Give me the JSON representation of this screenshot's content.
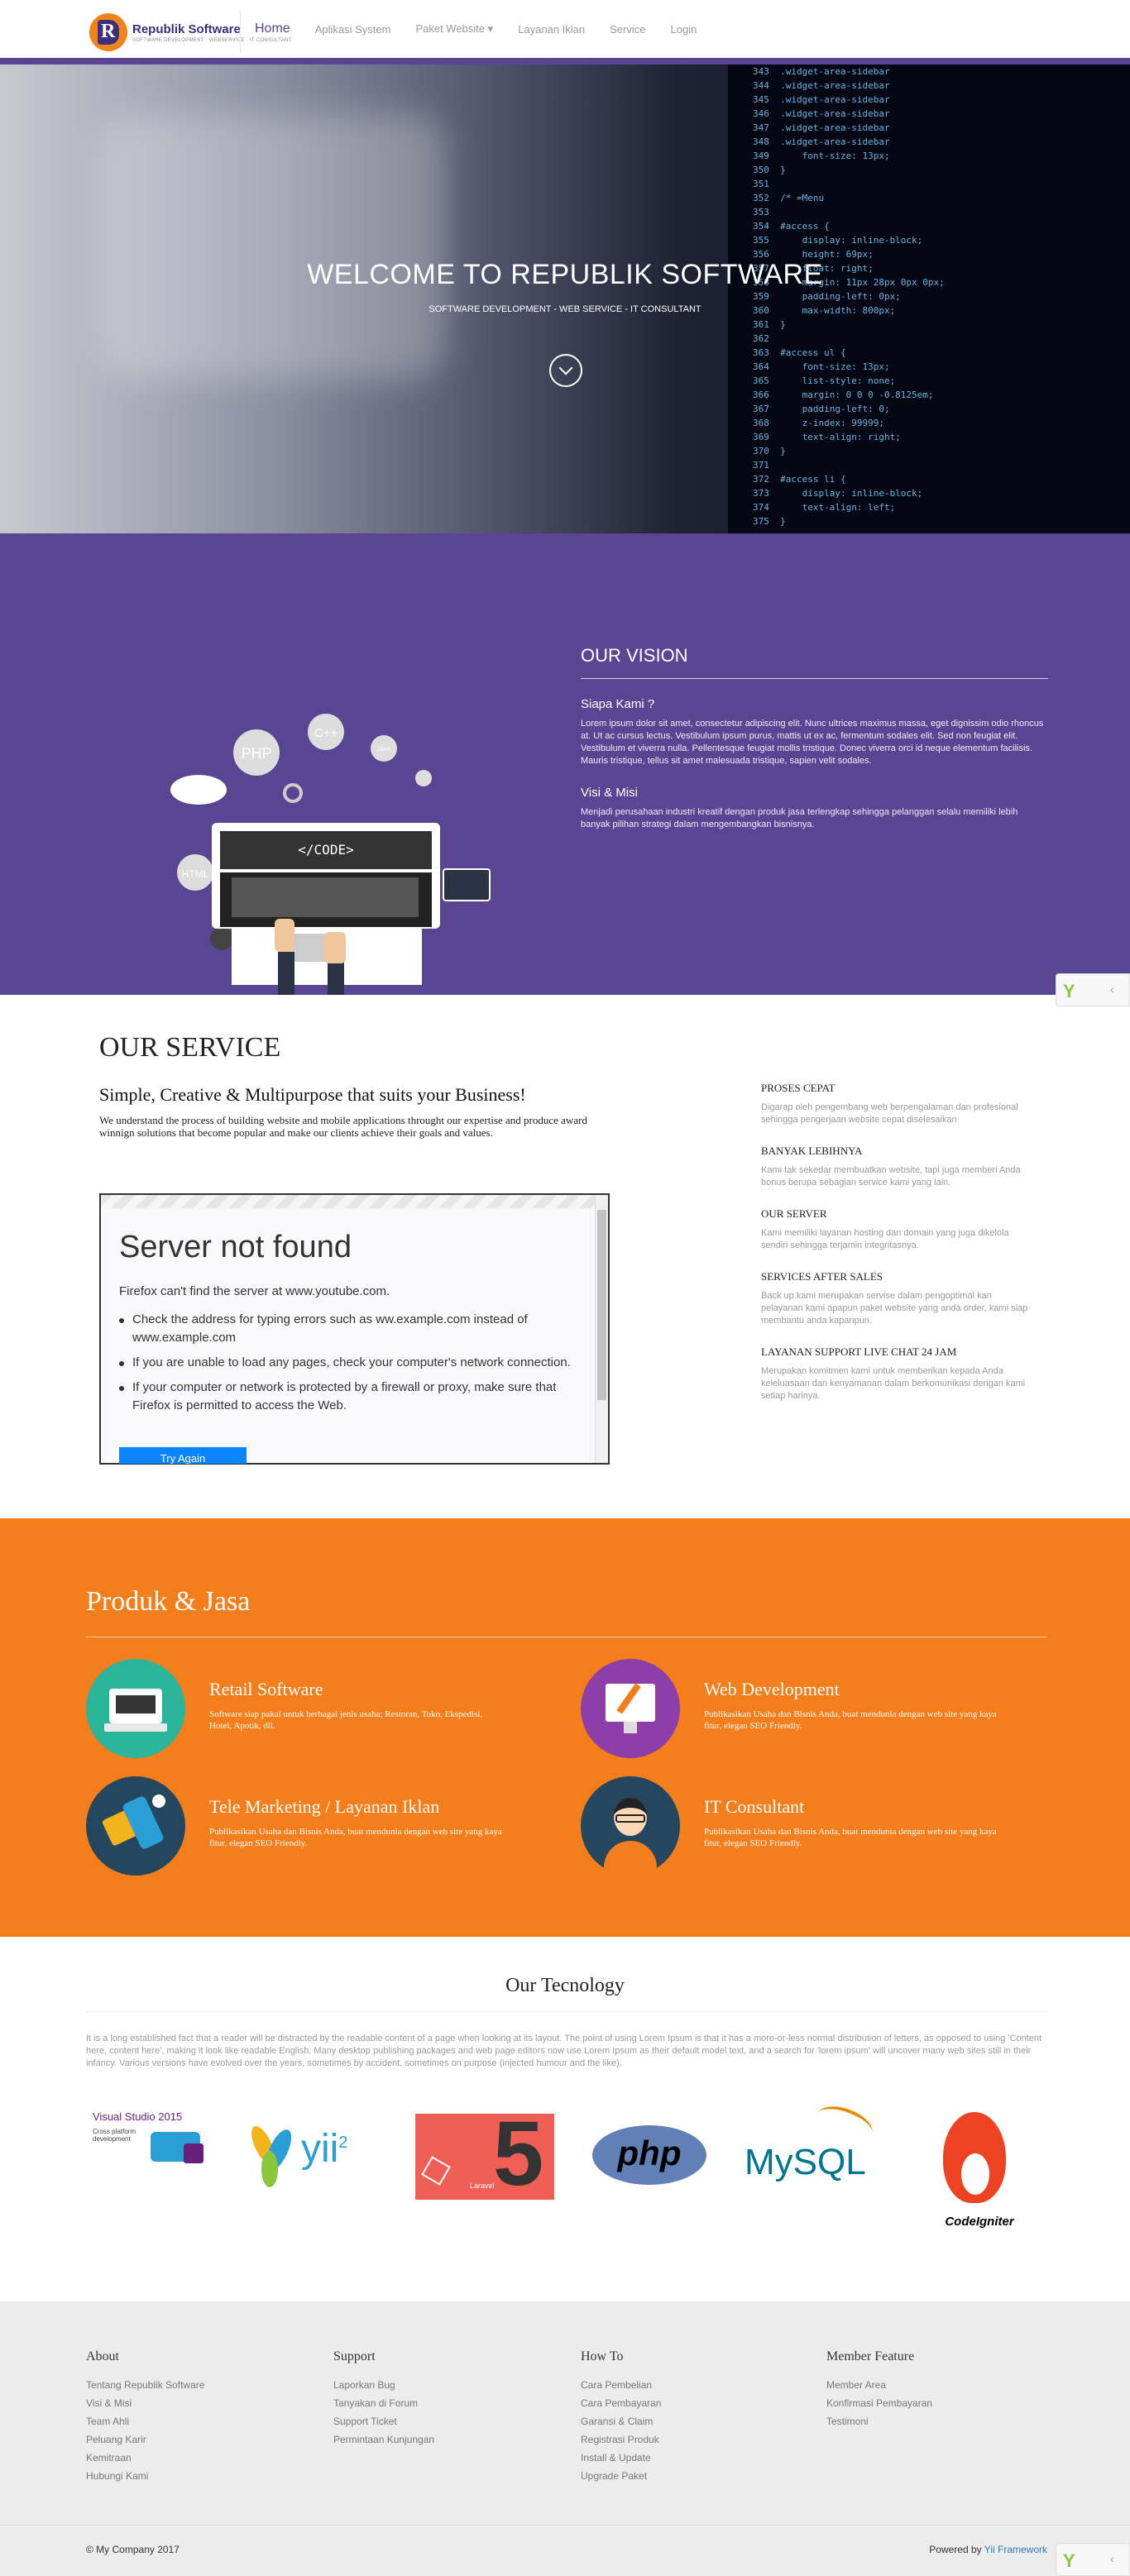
{
  "nav": {
    "brand_name": "Republik Software",
    "brand_tagline": "SOFTWARE DEVELOPMENT · WEBSERVICE · IT CONSULTANT",
    "items": [
      "Home",
      "Aplikasi System",
      "Paket Website",
      "Layanan Iklan",
      "Service",
      "Login"
    ],
    "caret": "▾"
  },
  "hero": {
    "title": "WELCOME TO REPUBLIK SOFTWARE",
    "subtitle": "SOFTWARE DEVELOPMENT - WEB SERVICE - IT CONSULTANT",
    "code": "343  .widget-area-sidebar\n344  .widget-area-sidebar\n345  .widget-area-sidebar\n346  .widget-area-sidebar\n347  .widget-area-sidebar\n348  .widget-area-sidebar\n349      font-size: 13px;\n350  }\n351\n352  /* =Menu\n353\n354  #access {\n355      display: inline-block;\n356      height: 69px;\n357      float: right;\n358      margin: 11px 28px 0px 0px;\n359      padding-left: 0px;\n360      max-width: 800px;\n361  }\n362\n363  #access ul {\n364      font-size: 13px;\n365      list-style: none;\n366      margin: 0 0 0 -0.8125em;\n367      padding-left: 0;\n368      z-index: 99999;\n369      text-align: right;\n370  }\n371\n372  #access li {\n373      display: inline-block;\n374      text-align: left;\n375  }"
  },
  "vision": {
    "title": "OUR VISION",
    "illus_labels": [
      "PHP",
      "C++",
      "JAVA",
      "HTML",
      "</CODE>"
    ],
    "who_title": "Siapa Kami ?",
    "who_text": "Lorem ipsum dolor sit amet, consectetur adipiscing elit. Nunc ultrices maximus massa, eget dignissim odio rhoncus at. Ut ac cursus lectus. Vestibulum ipsum purus, mattis ut ex ac, fermentum sodales elit. Sed non feugiat elit. Vestibulum et viverra nulla. Pellentesque feugiat mollis tristique. Donec viverra orci id neque elementum facilisis. Mauris tristique, tellus sit amet malesuada tristique, sapien velit sodales.",
    "misi_title": "Visi & Misi",
    "misi_text": "Menjadi perusahaan industri kreatif dengan produk jasa terlengkap sehingga pelanggan selalu memiliki lebih banyak pilihan strategi dalam mengembangkan bisnisnya."
  },
  "service": {
    "title": "OUR SERVICE",
    "subtitle": "Simple, Creative & Multipurpose that suits your Business!",
    "desc": "We understand the process of building website and mobile applications throught our expertise and produce award winnign solutions that become popular and make our clients achieve their goals and values.",
    "embed": {
      "heading": "Server not found",
      "text": "Firefox can't find the server at www.youtube.com.",
      "bullets": [
        "Check the address for typing errors such as ww.example.com instead of www.example.com",
        "If you are unable to load any pages, check your computer's network connection.",
        "If your computer or network is protected by a firewall or proxy, make sure that Firefox is permitted to access the Web."
      ],
      "button": "Try Again"
    },
    "features": [
      {
        "title": "PROSES CEPAT",
        "text": "Digarap oleh pengembang web berpengalaman dan profesional sehingga pengerjaan website cepat diselesaikan"
      },
      {
        "title": "BANYAK LEBIHNYA",
        "text": "Kami tak sekedar membuatkan website, tapi juga memberi Anda bonus berupa sebagian service kami yang lain."
      },
      {
        "title": "OUR SERVER",
        "text": "Kami memiliki layanan hosting dan domain yang juga dikelola sendiri sehingga terjamin integritasnya."
      },
      {
        "title": "SERVICES AFTER SALES",
        "text": "Back up kami merupakan servise dalam pengoptimal kan pelayanan kami apapun paket website yang anda order, kami siap membantu anda kapanpun."
      },
      {
        "title": "LAYANAN SUPPORT LIVE CHAT 24 JAM",
        "text": "Merupakan komitmen kami untuk memberikan kepada Anda keleluasaan dan kenyamanan dalam berkomunikasi dengan kami setiap harinya."
      }
    ]
  },
  "produk": {
    "title": "Produk & Jasa",
    "items": [
      {
        "title": "Retail Software",
        "text": "Software siap pakai untuk berbagai jenis usaha; Restoran, Toko, Ekspedisi, Hotel, Apotik, dll.",
        "color": "#2bb59b"
      },
      {
        "title": "Web Development",
        "text": "Publikasikan Usaha dan Bisnis Anda, buat mendunia dengan web site yang kaya fitur, elegan SEO Friendly.",
        "color": "#8e3ea8"
      },
      {
        "title": "Tele Marketing / Layanan Iklan",
        "text": "Publikasikan Usaha dan Bisnis Anda, buat mendunia dengan web site yang kaya fitur, elegan SEO Friendly.",
        "color": "#24465f"
      },
      {
        "title": "IT Consultant",
        "text": "Publikasikan Usaha dan Bisnis Anda, buat mendunia dengan web site yang kaya fitur, elegan SEO Friendly.",
        "color": "#24465f"
      }
    ]
  },
  "tech": {
    "title": "Our Tecnology",
    "text": "It is a long established fact that a reader will be distracted by the readable content of a page when looking at its layout. The point of using Lorem Ipsum is that it has a more-or-less normal distribution of letters, as opposed to using 'Content here, content here', making it look like readable English. Many desktop publishing packages and web page editors now use Lorem Ipsum as their default model text, and a search for 'lorem ipsum' will uncover many web sites still in their infancy. Various versions have evolved over the years, sometimes by accident, sometimes on purpose (injected humour and the like).",
    "logos": {
      "vs": "Visual Studio 2015",
      "vs_sub": "Cross platform development",
      "yii": "yii",
      "yii_sup": "2",
      "laravel": "5",
      "laravel_sub": "Laravel",
      "php": "php",
      "mysql": "MySQL",
      "ci": "CodeIgniter"
    }
  },
  "footer": {
    "cols": [
      {
        "title": "About",
        "links": [
          "Tentang Republik Software",
          "Visi & Misi",
          "Team Ahli",
          "Peluang Karir",
          "Kemitraan",
          "Hubungi Kami"
        ]
      },
      {
        "title": "Support",
        "links": [
          "Laporkan Bug",
          "Tanyakan di Forum",
          "Support Ticket",
          "Permintaan Kunjungan"
        ]
      },
      {
        "title": "How To",
        "links": [
          "Cara Pembelian",
          "Cara Pembayaran",
          "Garansi & Claim",
          "Registrasi Produk",
          "Install & Update",
          "Upgrade Paket"
        ]
      },
      {
        "title": "Member Feature",
        "links": [
          "Member Area",
          "Konfirmasi Pembayaran",
          "Testimoni"
        ]
      }
    ],
    "copyright": "© My Company 2017",
    "powered_prefix": "Powered by ",
    "powered_link": "Yii Framework"
  },
  "debug": {
    "logo": "Y",
    "toggle": "‹"
  }
}
